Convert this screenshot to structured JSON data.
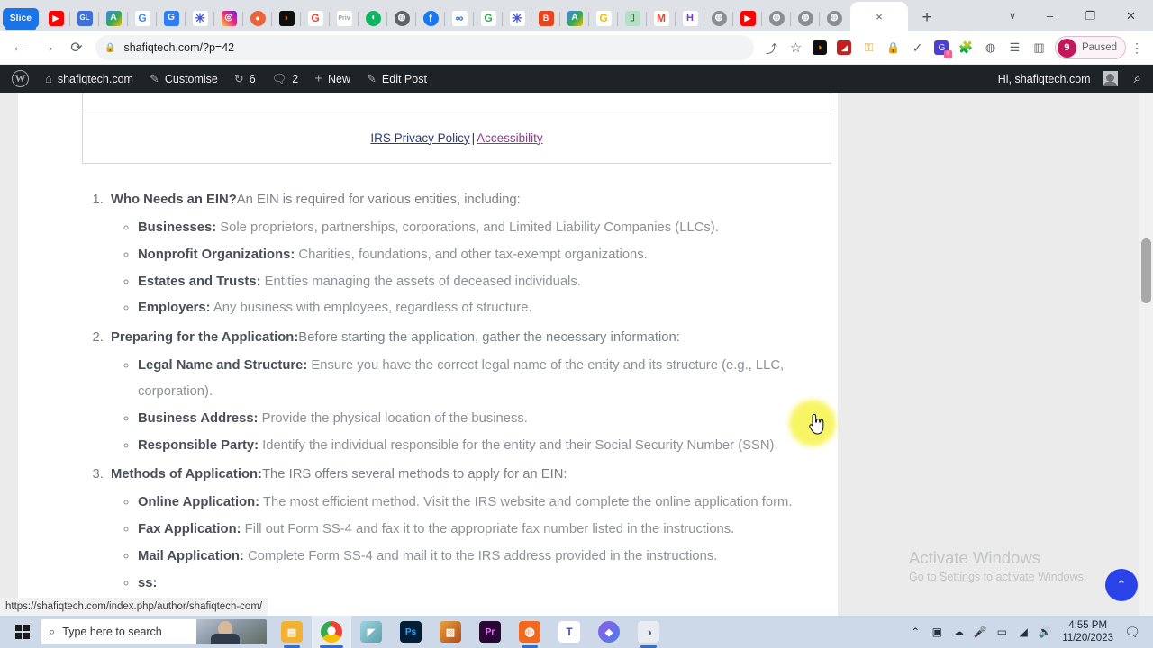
{
  "browser": {
    "pinned_tabs": [
      {
        "name": "slice-tab",
        "label": "Slice"
      },
      {
        "name": "youtube-tab",
        "label": "▶"
      },
      {
        "name": "gl-tab",
        "label": "GL"
      },
      {
        "name": "google-ads-tab",
        "label": "A"
      },
      {
        "name": "google-tab-1",
        "label": "G"
      },
      {
        "name": "grammarly-tab",
        "label": "G"
      },
      {
        "name": "asterisk-tab-1",
        "label": "✱"
      },
      {
        "name": "instagram-tab",
        "label": "◎"
      },
      {
        "name": "firefox-tab",
        "label": "●"
      },
      {
        "name": "semrush-tab",
        "label": "S"
      },
      {
        "name": "google-tab-2",
        "label": "G"
      },
      {
        "name": "priv-tab",
        "label": "Priv"
      },
      {
        "name": "leaf-tab",
        "label": "◑"
      },
      {
        "name": "globe-tab-1",
        "label": "◔"
      },
      {
        "name": "facebook-tab",
        "label": "f"
      },
      {
        "name": "meta-tab",
        "label": "∞"
      },
      {
        "name": "google-tab-3",
        "label": "G"
      },
      {
        "name": "asterisk-tab-2",
        "label": "✱"
      },
      {
        "name": "orange-tab",
        "label": "B"
      },
      {
        "name": "google-ads-tab-2",
        "label": "A"
      },
      {
        "name": "google-tab-4",
        "label": "G"
      },
      {
        "name": "green-doc-tab",
        "label": "□"
      },
      {
        "name": "gmail-tab",
        "label": "M"
      },
      {
        "name": "hubspot-tab",
        "label": "H"
      },
      {
        "name": "globe-tab-2",
        "label": "◔"
      },
      {
        "name": "youtube-tab-2",
        "label": "▶"
      },
      {
        "name": "globe-tab-3",
        "label": "◔"
      },
      {
        "name": "globe-tab-4",
        "label": "◔"
      },
      {
        "name": "globe-tab-5",
        "label": "◔"
      }
    ],
    "active_tab_close": "×",
    "new_tab": "+",
    "tab_search": "∨",
    "window_minimize": "–",
    "window_maximize": "❐",
    "window_close": "✕",
    "nav": {
      "back": "←",
      "forward": "→",
      "reload": "⟳"
    },
    "omnibox": {
      "lock_icon": "🔒",
      "url": "shafiqtech.com/?p=42"
    },
    "toolbar_icons": [
      {
        "name": "share-icon",
        "glyph": "⤴"
      },
      {
        "name": "bookmark-star-icon",
        "glyph": "☆"
      },
      {
        "name": "semrush-extension-icon",
        "glyph": "S"
      },
      {
        "name": "red-extension-icon",
        "glyph": "◢"
      },
      {
        "name": "lock-gold-extension-icon",
        "glyph": "⚿"
      },
      {
        "name": "padlock-extension-icon",
        "glyph": "■"
      },
      {
        "name": "checkmark-extension-icon",
        "glyph": "✓"
      },
      {
        "name": "grammarly-extension-icon",
        "glyph": "G"
      },
      {
        "name": "extensions-puzzle-icon",
        "glyph": "❖"
      },
      {
        "name": "shield-extension-icon",
        "glyph": "○"
      },
      {
        "name": "reading-list-icon",
        "glyph": "≣"
      },
      {
        "name": "side-panel-icon",
        "glyph": "◫"
      }
    ],
    "profile": {
      "initial": "9",
      "status": "Paused"
    },
    "menu_kebab": "⋮"
  },
  "wp_admin_bar": {
    "logo": "W",
    "site_name": "shafiqtech.com",
    "customise": "Customise",
    "updates_count": "6",
    "comments_count": "2",
    "new": "New",
    "edit_post": "Edit Post",
    "greeting": "Hi, shafiqtech.com",
    "search_icon": "⌕",
    "icons": {
      "site": "⌂",
      "customise": "✎",
      "updates": "↻",
      "comments": "⚇",
      "new": "+",
      "edit": "✎"
    }
  },
  "page": {
    "irs_box": {
      "privacy_policy": "IRS Privacy Policy",
      "separator": "|",
      "accessibility": "Accessibility"
    },
    "list": [
      {
        "num": "1",
        "title": "Who Needs an EIN?",
        "lead": "An EIN is required for various entities, including:",
        "items": [
          {
            "term": "Businesses:",
            "desc": " Sole proprietors, partnerships, corporations, and Limited Liability Companies (LLCs)."
          },
          {
            "term": "Nonprofit Organizations:",
            "desc": " Charities, foundations, and other tax-exempt organizations."
          },
          {
            "term": "Estates and Trusts:",
            "desc": " Entities managing the assets of deceased individuals."
          },
          {
            "term": "Employers:",
            "desc": " Any business with employees, regardless of structure."
          }
        ]
      },
      {
        "num": "2",
        "title": "Preparing for the Application:",
        "lead": "Before starting the application, gather the necessary information:",
        "items": [
          {
            "term": "Legal Name and Structure:",
            "desc": " Ensure you have the correct legal name of the entity and its structure (e.g., LLC, corporation)."
          },
          {
            "term": "Business Address:",
            "desc": " Provide the physical location of the business."
          },
          {
            "term": "Responsible Party:",
            "desc": " Identify the individual responsible for the entity and their Social Security Number (SSN)."
          }
        ]
      },
      {
        "num": "3",
        "title": "Methods of Application:",
        "lead": "The IRS offers several methods to apply for an EIN:",
        "items": [
          {
            "term": "Online Application:",
            "desc": " The most efficient method. Visit the IRS website and complete the online application form."
          },
          {
            "term": "Fax Application:",
            "desc": " Fill out Form SS-4 and fax it to the appropriate fax number listed in the instructions."
          },
          {
            "term": "Mail Application:",
            "desc": " Complete Form SS-4 and mail it to the IRS address provided in the instructions."
          },
          {
            "term": "ss:",
            "desc": ""
          }
        ]
      }
    ],
    "scroll_to_top": "⌃"
  },
  "status_bar": {
    "url": "https://shafiqtech.com/index.php/author/shafiqtech-com/"
  },
  "watermark": {
    "line1": "Activate Windows",
    "line2": "Go to Settings to activate Windows."
  },
  "taskbar": {
    "search_placeholder": "Type here to search",
    "search_icon": "⌕",
    "apps": [
      {
        "name": "file-explorer",
        "label": "▤",
        "color": "#f2b133"
      },
      {
        "name": "google-chrome",
        "label": "●",
        "color": "#4285f4"
      },
      {
        "name": "teal-app",
        "label": "◤",
        "color": "#6fbcc7"
      },
      {
        "name": "adobe-photoshop",
        "label": "Ps",
        "color": "#001e36"
      },
      {
        "name": "orange-design-app",
        "label": "▓",
        "color": "#d8762a"
      },
      {
        "name": "adobe-premiere-pro",
        "label": "Pr",
        "color": "#2a0634"
      },
      {
        "name": "orange-circle-app",
        "label": "●",
        "color": "#f2681f"
      },
      {
        "name": "microsoft-teams",
        "label": "T",
        "color": "#4b53bc"
      },
      {
        "name": "purple-app",
        "label": "◆",
        "color": "#7a4fd6"
      },
      {
        "name": "bittorrent",
        "label": "◐",
        "color": "#5d6b77"
      }
    ],
    "tray_icons": [
      {
        "name": "show-hidden-icons",
        "glyph": "∧"
      },
      {
        "name": "display-icon",
        "glyph": "▣"
      },
      {
        "name": "onedrive-icon",
        "glyph": "☁"
      },
      {
        "name": "microphone-icon",
        "glyph": "♩"
      },
      {
        "name": "battery-icon",
        "glyph": "▭"
      },
      {
        "name": "wifi-icon",
        "glyph": "◠"
      },
      {
        "name": "volume-icon",
        "glyph": "🔊"
      }
    ],
    "time": "4:55 PM",
    "date": "11/20/2023",
    "notification_icon": "▤"
  }
}
